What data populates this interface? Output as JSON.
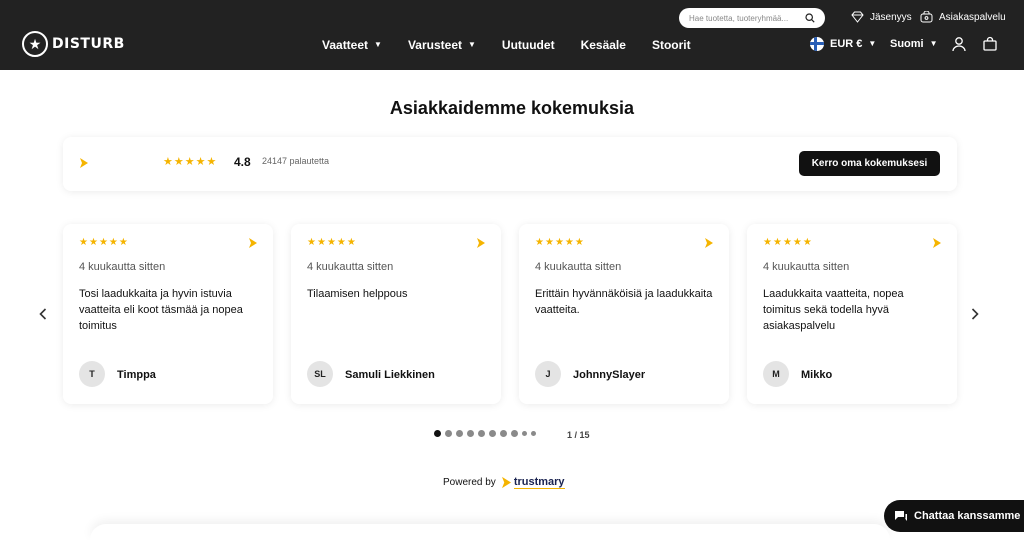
{
  "header": {
    "logo_text": "DISTURB",
    "search_placeholder": "Hae tuotetta, tuoteryhmää...",
    "top_links": [
      {
        "label": "Jäsenyys",
        "icon": "diamond-icon"
      },
      {
        "label": "Asiakaspalvelu",
        "icon": "support-icon"
      }
    ],
    "nav": [
      {
        "label": "Vaatteet",
        "has_dropdown": true
      },
      {
        "label": "Varusteet",
        "has_dropdown": true
      },
      {
        "label": "Uutuudet",
        "has_dropdown": false
      },
      {
        "label": "Kesäale",
        "has_dropdown": false
      },
      {
        "label": "Stoorit",
        "has_dropdown": false
      }
    ],
    "currency": "EUR €",
    "language": "Suomi",
    "colors": {
      "background": "#222222",
      "text": "#ffffff"
    }
  },
  "reviews_section": {
    "title": "Asiakkaidemme kokemuksia",
    "summary": {
      "stars": 5,
      "rating": "4.8",
      "count_text": "24147 palautetta",
      "cta_label": "Kerro oma kokemuksesi"
    },
    "cards": [
      {
        "stars": 5,
        "time": "4 kuukautta sitten",
        "text": "Tosi laadukkaita ja hyvin istuvia vaatteita eli koot täsmää ja nopea toimitus",
        "initials": "T",
        "author": "Timppa"
      },
      {
        "stars": 5,
        "time": "4 kuukautta sitten",
        "text": "Tilaamisen helppous",
        "initials": "SL",
        "author": "Samuli Liekkinen"
      },
      {
        "stars": 5,
        "time": "4 kuukautta sitten",
        "text": "Erittäin hyvännäköisiä ja laadukkaita vaatteita.",
        "initials": "J",
        "author": "JohnnySlayer"
      },
      {
        "stars": 5,
        "time": "4 kuukautta sitten",
        "text": "Laadukkaita vaatteita, nopea toimitus sekä todella hyvä asiakaspalvelu",
        "initials": "M",
        "author": "Mikko"
      }
    ],
    "pagination": {
      "current": 1,
      "total": 15,
      "label": "1 / 15",
      "visible_dots": 10
    },
    "powered_by": {
      "label": "Powered by",
      "brand": "trustmary"
    },
    "colors": {
      "star": "#f5b400",
      "button": "#111111",
      "brand_accent": "#f5b400"
    }
  },
  "chat": {
    "label": "Chattaa kanssamme"
  }
}
